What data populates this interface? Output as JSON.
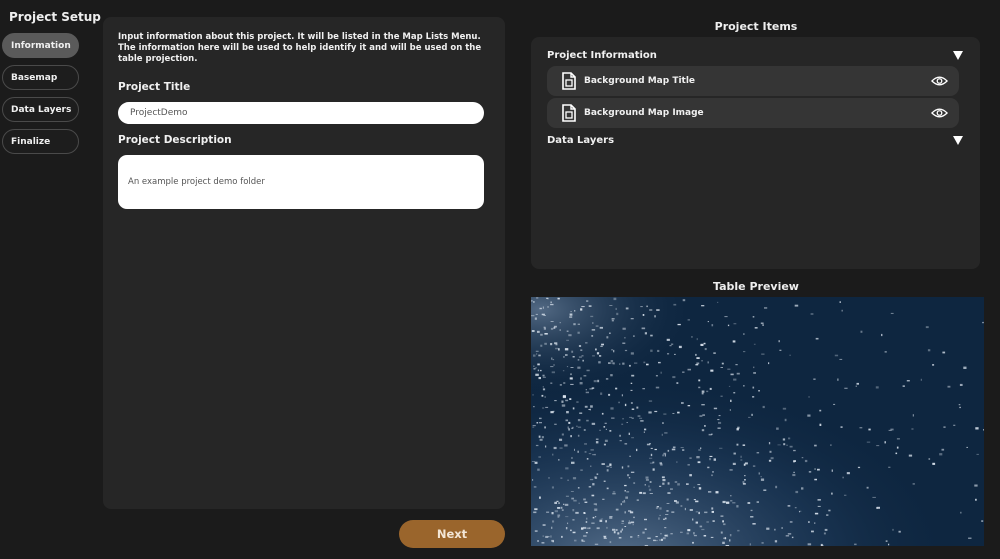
{
  "sidebar": {
    "title": "Project Setup",
    "items": [
      {
        "label": "Information",
        "active": true
      },
      {
        "label": "Basemap",
        "active": false
      },
      {
        "label": "Data Layers",
        "active": false
      },
      {
        "label": "Finalize",
        "active": false
      }
    ]
  },
  "form": {
    "intro": "Input information about this project. It will be listed in the Map Lists Menu. The information here will be used to help identify it and will be used on the table projection.",
    "title_label": "Project Title",
    "title_value": "ProjectDemo",
    "description_label": "Project Description",
    "description_value": "An example project demo folder"
  },
  "footer": {
    "next_label": "Next"
  },
  "project_items": {
    "heading": "Project Items",
    "sections": [
      {
        "label": "Project Information",
        "items": [
          {
            "label": "Background Map Title",
            "icon": "file-icon",
            "action_icon": "eye-icon"
          },
          {
            "label": "Background Map Image",
            "icon": "file-icon",
            "action_icon": "eye-icon"
          }
        ]
      },
      {
        "label": "Data Layers",
        "items": []
      }
    ]
  },
  "preview": {
    "heading": "Table Preview"
  },
  "colors": {
    "background": "#1b1b1b",
    "panel": "#262626",
    "item_row": "#353535",
    "active_nav": "#5a5a5a",
    "accent": "#9a652c",
    "preview_base": "#0e2640"
  }
}
